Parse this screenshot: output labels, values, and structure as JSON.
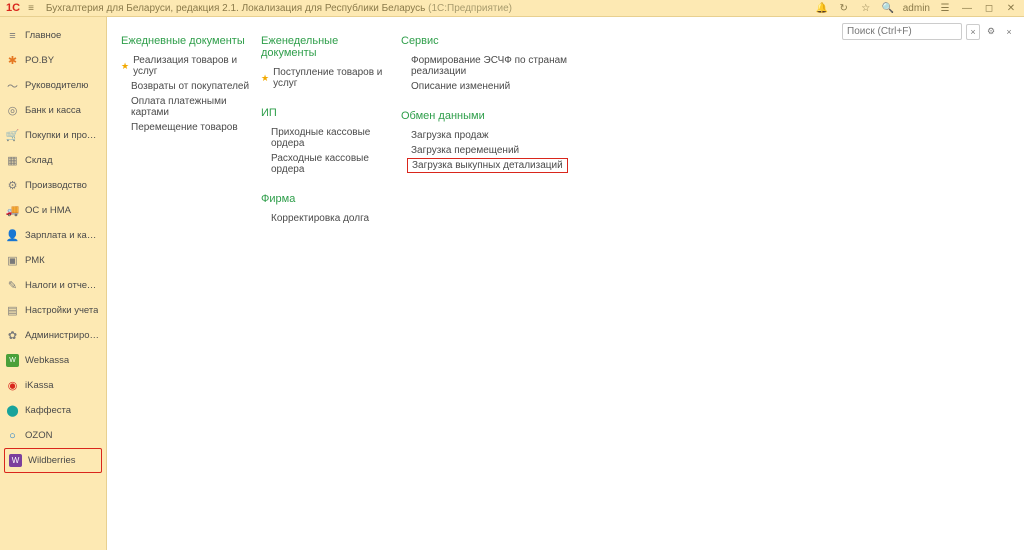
{
  "header": {
    "logo": "1C",
    "breadcrumb_main": "Бухгалтерия для Беларуси, редакция 2.1. Локализация для Республики Беларусь",
    "breadcrumb_suffix": "(1С:Предприятие)",
    "user": "admin"
  },
  "search": {
    "placeholder": "Поиск (Ctrl+F)"
  },
  "sidebar": [
    {
      "icon": "≡",
      "cls": "gray",
      "label": "Главное"
    },
    {
      "icon": "✱",
      "cls": "orange",
      "label": "PO.BY"
    },
    {
      "icon": "〜",
      "cls": "gray",
      "label": "Руководителю"
    },
    {
      "icon": "◎",
      "cls": "gray",
      "label": "Банк и касса"
    },
    {
      "icon": "🛒",
      "cls": "gray",
      "label": "Покупки и продажи"
    },
    {
      "icon": "▦",
      "cls": "gray",
      "label": "Склад"
    },
    {
      "icon": "⚙",
      "cls": "gray",
      "label": "Производство"
    },
    {
      "icon": "🚚",
      "cls": "gray",
      "label": "ОС и НМА"
    },
    {
      "icon": "👤",
      "cls": "gray",
      "label": "Зарплата и кадры"
    },
    {
      "icon": "▣",
      "cls": "gray",
      "label": "РМК"
    },
    {
      "icon": "✎",
      "cls": "gray",
      "label": "Налоги и отчетность"
    },
    {
      "icon": "▤",
      "cls": "gray",
      "label": "Настройки учета"
    },
    {
      "icon": "✿",
      "cls": "gray",
      "label": "Администрирование"
    },
    {
      "icon": "W",
      "cls": "green",
      "label": "Webkassa"
    },
    {
      "icon": "◉",
      "cls": "red",
      "label": "iKassa"
    },
    {
      "icon": "⬤",
      "cls": "teal",
      "label": "Каффеста"
    },
    {
      "icon": "○",
      "cls": "blue",
      "label": "OZON"
    },
    {
      "icon": "W",
      "cls": "purple",
      "label": "Wildberries",
      "selected": true
    }
  ],
  "col1": {
    "title": "Ежедневные документы",
    "items": [
      {
        "text": "Реализация товаров и услуг",
        "star": true
      },
      {
        "text": "Возвраты от покупателей"
      },
      {
        "text": "Оплата платежными картами"
      },
      {
        "text": "Перемещение товаров"
      }
    ]
  },
  "col2a": {
    "title": "Еженедельные документы",
    "items": [
      {
        "text": "Поступление товаров и услуг",
        "star": true
      }
    ]
  },
  "col2b": {
    "title": "ИП",
    "items": [
      {
        "text": "Приходные кассовые ордера"
      },
      {
        "text": "Расходные кассовые ордера"
      }
    ]
  },
  "col2c": {
    "title": "Фирма",
    "items": [
      {
        "text": "Корректировка долга"
      }
    ]
  },
  "col3a": {
    "title": "Сервис",
    "items": [
      {
        "text": "Формирование ЭСЧФ по странам реализации"
      },
      {
        "text": "Описание изменений"
      }
    ]
  },
  "col3b": {
    "title": "Обмен данными",
    "items": [
      {
        "text": "Загрузка продаж"
      },
      {
        "text": "Загрузка перемещений"
      },
      {
        "text": "Загрузка выкупных детализаций",
        "highlight": true
      }
    ]
  }
}
